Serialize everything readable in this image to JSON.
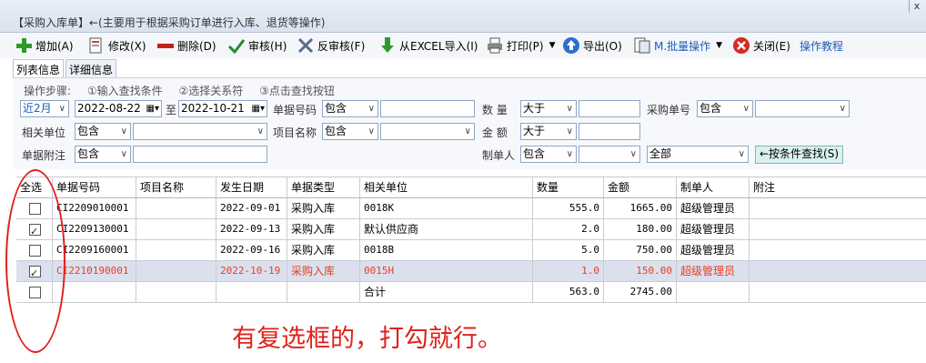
{
  "window": {
    "title": "【采购入库单】←(主要用于根据采购订单进行入库、退货等操作)",
    "close": "x"
  },
  "toolbar": {
    "add": "增加(A)",
    "edit": "修改(X)",
    "delete": "删除(D)",
    "audit": "审核(H)",
    "unaudit": "反审核(F)",
    "import_excel": "从EXCEL导入(I)",
    "print": "打印(P)",
    "export": "导出(O)",
    "batch": "M.批量操作",
    "close": "关闭(E)",
    "tutorial": "操作教程"
  },
  "tabs": [
    "列表信息",
    "详细信息"
  ],
  "filters": {
    "steps": [
      "操作步骤:",
      "①输入查找条件",
      "②选择关系符",
      "③点击查找按钮"
    ],
    "period": "近2月",
    "date_from": "2022-08-22",
    "date_to_label": "至",
    "date_to": "2022-10-21",
    "doc_no_label": "单据号码",
    "doc_no_op": "包含",
    "qty_label": "数 量",
    "qty_op": "大于",
    "po_no_label": "采购单号",
    "po_no_op": "包含",
    "partner_label": "相关单位",
    "partner_op": "包含",
    "project_label": "项目名称",
    "project_op": "包含",
    "amount_label": "金 额",
    "amount_op": "大于",
    "note_label": "单据附注",
    "note_op": "包含",
    "maker_label": "制单人",
    "maker_op": "包含",
    "status": "全部",
    "search_button": "←按条件查找(S)"
  },
  "table": {
    "headers": [
      "全选",
      "单据号码",
      "项目名称",
      "发生日期",
      "单据类型",
      "相关单位",
      "数量",
      "金额",
      "制单人",
      "附注"
    ],
    "rows": [
      {
        "checked": false,
        "doc_no": "CI2209010001",
        "project": "",
        "date": "2022-09-01",
        "type": "采购入库",
        "partner": "0018K",
        "qty": "555.0",
        "amount": "1665.00",
        "maker": "超级管理员",
        "note": ""
      },
      {
        "checked": true,
        "doc_no": "CI2209130001",
        "project": "",
        "date": "2022-09-13",
        "type": "采购入库",
        "partner": "默认供应商",
        "qty": "2.0",
        "amount": "180.00",
        "maker": "超级管理员",
        "note": ""
      },
      {
        "checked": false,
        "doc_no": "CI2209160001",
        "project": "",
        "date": "2022-09-16",
        "type": "采购入库",
        "partner": "0018B",
        "qty": "5.0",
        "amount": "750.00",
        "maker": "超级管理员",
        "note": ""
      },
      {
        "checked": true,
        "doc_no": "CI2210190001",
        "project": "",
        "date": "2022-10-19",
        "type": "采购入库",
        "partner": "0015H",
        "qty": "1.0",
        "amount": "150.00",
        "maker": "超级管理员",
        "note": ""
      }
    ],
    "total": {
      "checked": false,
      "label": "合计",
      "qty": "563.0",
      "amount": "2745.00"
    }
  },
  "annotation": "有复选框的，打勾就行。",
  "colors": {
    "highlight_text": "#e8401c",
    "annotation": "#e0221c",
    "selected_row": "#dcdfee"
  }
}
